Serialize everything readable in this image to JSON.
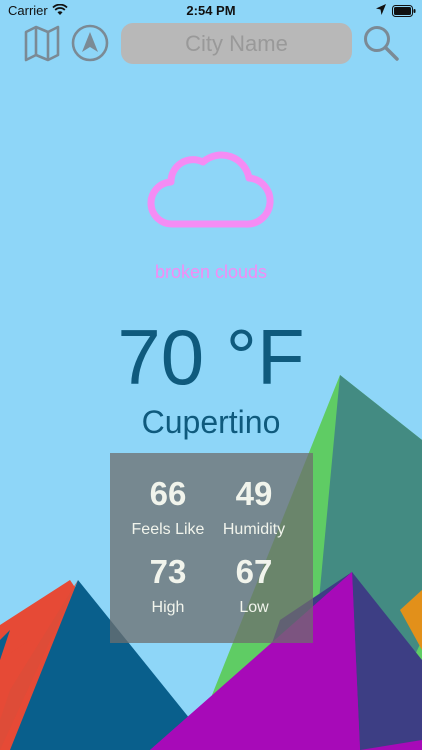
{
  "status_bar": {
    "carrier": "Carrier",
    "time": "2:54 PM"
  },
  "toolbar": {
    "search_placeholder": "City Name",
    "map_icon": "map-icon",
    "location_icon": "navigation-arrow-icon",
    "search_icon": "magnifier-icon",
    "icon_color": "#7b8a95"
  },
  "weather": {
    "condition_icon": "cloud-icon",
    "condition": "broken clouds",
    "temperature": "70 °F",
    "city": "Cupertino",
    "accent_color": "#f48cf4",
    "text_color": "#0f5a7d"
  },
  "stats": {
    "feels_like_value": "66",
    "feels_like_label": "Feels Like",
    "humidity_value": "49",
    "humidity_label": "Humidity",
    "high_value": "73",
    "high_label": "High",
    "low_value": "67",
    "low_label": "Low"
  }
}
